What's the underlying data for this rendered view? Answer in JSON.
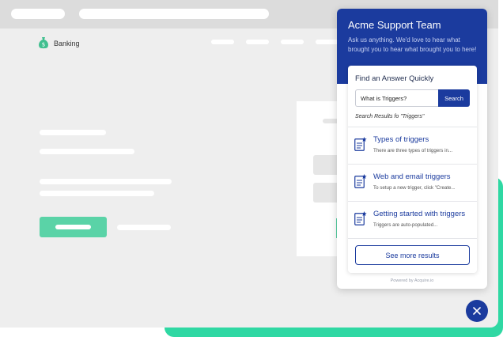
{
  "background_page": {
    "brand_name": "Banking",
    "icon": "money-bag-icon"
  },
  "widget": {
    "title": "Acme Support Team",
    "subtitle": "Ask us anything. We'd love to hear what brought you to hear what brought you to here!",
    "search_section_title": "Find an Answer Quickly",
    "search": {
      "value": "What is Triggers?",
      "button_label": "Search"
    },
    "results_label": "Search Results fo \"Triggers\"",
    "results": [
      {
        "title": "Types of triggers",
        "snippet": "There are three types of triggers in..."
      },
      {
        "title": "Web and email triggers",
        "snippet": "To setup a new trigger, click \"Create..."
      },
      {
        "title": "Getting started with triggers",
        "snippet": "Triggers are auto-populated..."
      }
    ],
    "see_more_label": "See more results",
    "powered_by": "Powered by Acquire.io",
    "close_icon": "close-icon"
  },
  "colors": {
    "primary": "#1b3b9e",
    "accent_green": "#2fd8a3",
    "button_green": "#5ad3a7",
    "page_bg": "#eeeeee"
  }
}
